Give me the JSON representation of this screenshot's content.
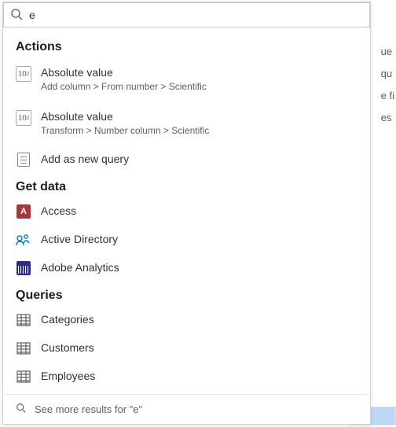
{
  "search": {
    "value": "e",
    "placeholder": ""
  },
  "sections": {
    "actions": {
      "header": "Actions",
      "items": [
        {
          "title": "Absolute value",
          "subtitle": "Add column > From number > Scientific"
        },
        {
          "title": "Absolute value",
          "subtitle": "Transform > Number column > Scientific"
        },
        {
          "title": "Add as new query"
        }
      ]
    },
    "getdata": {
      "header": "Get data",
      "items": [
        {
          "title": "Access"
        },
        {
          "title": "Active Directory"
        },
        {
          "title": "Adobe Analytics"
        }
      ]
    },
    "queries": {
      "header": "Queries",
      "items": [
        {
          "title": "Categories"
        },
        {
          "title": "Customers"
        },
        {
          "title": "Employees"
        }
      ]
    }
  },
  "footer": {
    "text": "See more results for \"e\""
  },
  "background": {
    "s0": "ue",
    "s1": "qu",
    "s2": "e fi",
    "s3": "es"
  }
}
